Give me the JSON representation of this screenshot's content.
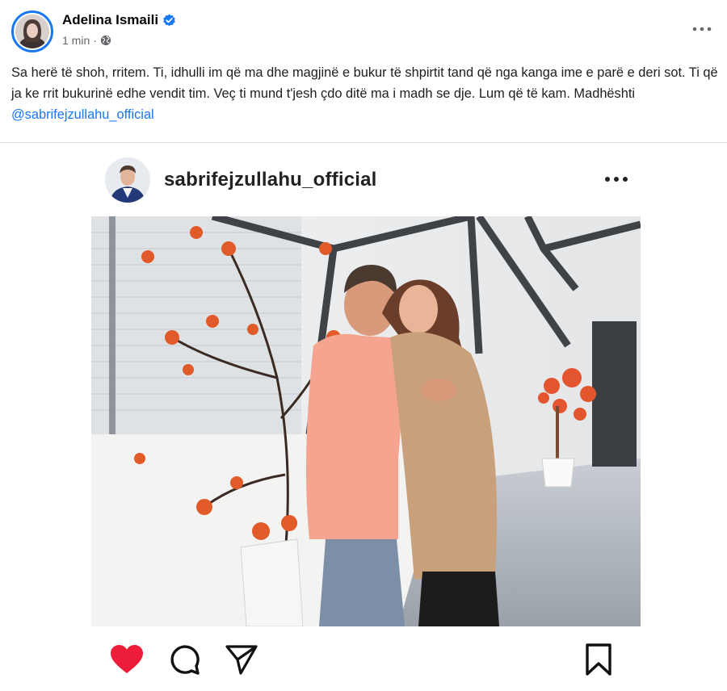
{
  "post": {
    "author_name": "Adelina Ismaili",
    "timestamp": "1 min",
    "separator": "·",
    "text_main": "Sa herë të shoh, rritem. Ti, idhulli im që ma dhe magjinë e bukur të shpirtit tand që nga kanga ime e parë e deri sot. Ti që ja ke rrit bukurinë edhe vendit tim. Veç ti mund t'jesh çdo ditë ma i madh se dje. Lum që të kam. Madhështi ",
    "mention": "@sabrifejzullahu_official"
  },
  "embed": {
    "username": "sabrifejzullahu_official"
  },
  "icons": {
    "verified": "verified-badge-icon",
    "privacy": "globe-icon",
    "more": "more-options-icon",
    "like": "heart-icon",
    "comment": "comment-icon",
    "share": "send-icon",
    "save": "bookmark-icon"
  },
  "colors": {
    "brand_blue": "#1877f2",
    "like_red": "#ed1c3a",
    "muted_text": "#65676b"
  }
}
